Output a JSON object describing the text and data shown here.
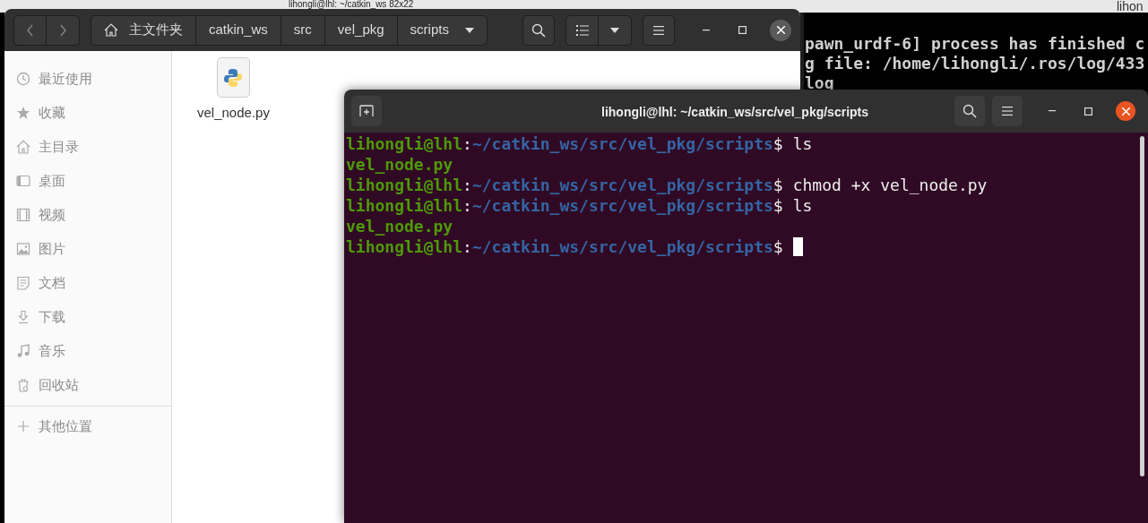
{
  "background_window": {
    "title": "lihongli@lhl: ~/catkin_ws 82x22"
  },
  "right_terminal": {
    "title": "lihon",
    "lines": [
      "pawn_urdf-6] process has finished c",
      "g file: /home/lihongli/.ros/log/433",
      "log"
    ]
  },
  "file_manager": {
    "path": [
      {
        "label": "主文件夹",
        "kind": "home"
      },
      {
        "label": "catkin_ws",
        "kind": "folder"
      },
      {
        "label": "src",
        "kind": "folder"
      },
      {
        "label": "vel_pkg",
        "kind": "folder"
      },
      {
        "label": "scripts",
        "kind": "current"
      }
    ],
    "sidebar": [
      {
        "label": "最近使用",
        "kind": "recent"
      },
      {
        "label": "收藏",
        "kind": "starred"
      },
      {
        "label": "主目录",
        "kind": "home"
      },
      {
        "label": "桌面",
        "kind": "desktop"
      },
      {
        "label": "视频",
        "kind": "video"
      },
      {
        "label": "图片",
        "kind": "image"
      },
      {
        "label": "文档",
        "kind": "document"
      },
      {
        "label": "下载",
        "kind": "download"
      },
      {
        "label": "音乐",
        "kind": "music"
      },
      {
        "label": "回收站",
        "kind": "trash"
      }
    ],
    "other_locations": {
      "label": "其他位置"
    },
    "files": [
      {
        "name": "vel_node.py",
        "kind": "python"
      }
    ]
  },
  "terminal": {
    "title": "lihongli@lhl: ~/catkin_ws/src/vel_pkg/scripts",
    "lines": [
      {
        "kind": "prompt",
        "user": "lihongli@lhl",
        "sep": ":",
        "path": "~/catkin_ws/src/vel_pkg/scripts",
        "symbol": "$",
        "command": "ls"
      },
      {
        "kind": "output",
        "text": "vel_node.py"
      },
      {
        "kind": "prompt",
        "user": "lihongli@lhl",
        "sep": ":",
        "path": "~/catkin_ws/src/vel_pkg/scripts",
        "symbol": "$",
        "command": "chmod +x vel_node.py"
      },
      {
        "kind": "prompt",
        "user": "lihongli@lhl",
        "sep": ":",
        "path": "~/catkin_ws/src/vel_pkg/scripts",
        "symbol": "$",
        "command": "ls"
      },
      {
        "kind": "output",
        "text": "vel_node.py"
      },
      {
        "kind": "prompt",
        "user": "lihongli@lhl",
        "sep": ":",
        "path": "~/catkin_ws/src/vel_pkg/scripts",
        "symbol": "$",
        "cursor": true
      }
    ]
  }
}
